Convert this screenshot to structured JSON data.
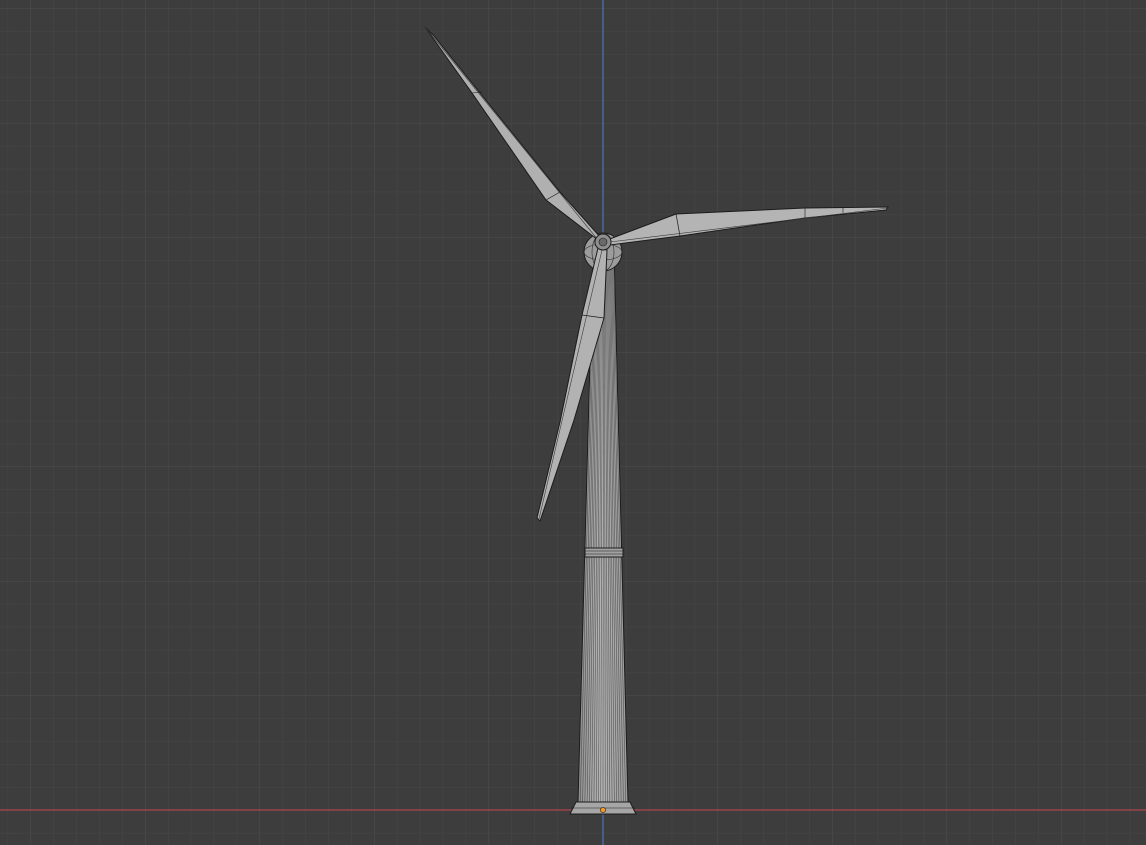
{
  "viewport": {
    "background_color": "#3d3d3d",
    "grid_minor_color": "#474747",
    "grid_major_color": "#4f4f4f",
    "axis_x_color": "#c8484f",
    "axis_z_color": "#4f7fd2",
    "mesh_fill_color": "#a9a9a9",
    "mesh_edge_color": "#1c1c1c",
    "origin_color": "#f39a1c"
  },
  "scene": {
    "object": "wind-turbine",
    "parts": [
      "tower",
      "tower-flange",
      "tower-base",
      "hub",
      "spinner",
      "blade-upper-left",
      "blade-right",
      "blade-lower"
    ],
    "origin_marker": "object-origin-dot"
  }
}
